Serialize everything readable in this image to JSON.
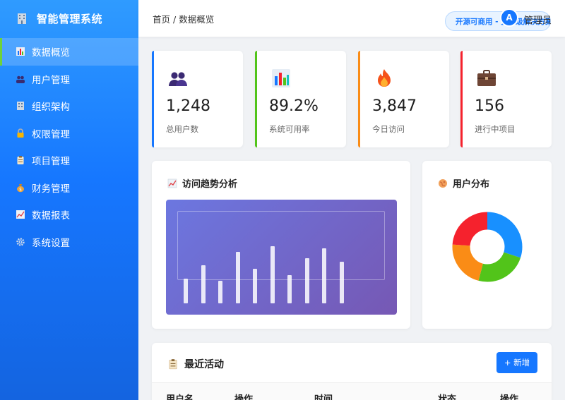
{
  "app": {
    "title": "智能管理系统",
    "logo_icon": "building-icon"
  },
  "sidebar": {
    "items": [
      {
        "label": "数据概览",
        "icon": "bar-chart-icon",
        "active": true
      },
      {
        "label": "用户管理",
        "icon": "users-icon"
      },
      {
        "label": "组织架构",
        "icon": "building-icon"
      },
      {
        "label": "权限管理",
        "icon": "lock-icon"
      },
      {
        "label": "项目管理",
        "icon": "clipboard-icon"
      },
      {
        "label": "财务管理",
        "icon": "money-bag-icon"
      },
      {
        "label": "数据报表",
        "icon": "line-chart-icon"
      },
      {
        "label": "系统设置",
        "icon": "gear-icon"
      }
    ]
  },
  "header": {
    "breadcrumb_home": "首页",
    "breadcrumb_sep": "/",
    "breadcrumb_current": "数据概览",
    "badge": "开源可商用 - 企业级解决方案",
    "avatar_letter": "A",
    "username": "管理员"
  },
  "stats": [
    {
      "value": "1,248",
      "label": "总用户数",
      "icon": "users-icon",
      "color": "#1677ff"
    },
    {
      "value": "89.2%",
      "label": "系统可用率",
      "icon": "bar-chart-icon",
      "color": "#52c41a"
    },
    {
      "value": "3,847",
      "label": "今日访问",
      "icon": "fire-icon",
      "color": "#fa8c16"
    },
    {
      "value": "156",
      "label": "进行中项目",
      "icon": "briefcase-icon",
      "color": "#f5222d"
    }
  ],
  "trend": {
    "title": "访问趋势分析",
    "icon": "line-chart-icon",
    "bars": [
      0.32,
      0.49,
      0.29,
      0.66,
      0.45,
      0.74,
      0.36,
      0.58,
      0.71,
      0.54
    ]
  },
  "distribution": {
    "title": "用户分布",
    "icon": "globe-icon",
    "segments": [
      {
        "color": "#1890ff",
        "value": 0.3
      },
      {
        "color": "#52c41a",
        "value": 0.24
      },
      {
        "color": "#fa8c16",
        "value": 0.22
      },
      {
        "color": "#f5222d",
        "value": 0.24
      }
    ]
  },
  "activity": {
    "title": "最近活动",
    "icon": "clipboard-icon",
    "add_button": "+ 新增",
    "columns": [
      "用户名",
      "操作",
      "时间",
      "状态",
      "操作"
    ]
  },
  "colors": {
    "primary": "#1677ff",
    "sidebar_active_marker": "#6fd23a"
  }
}
